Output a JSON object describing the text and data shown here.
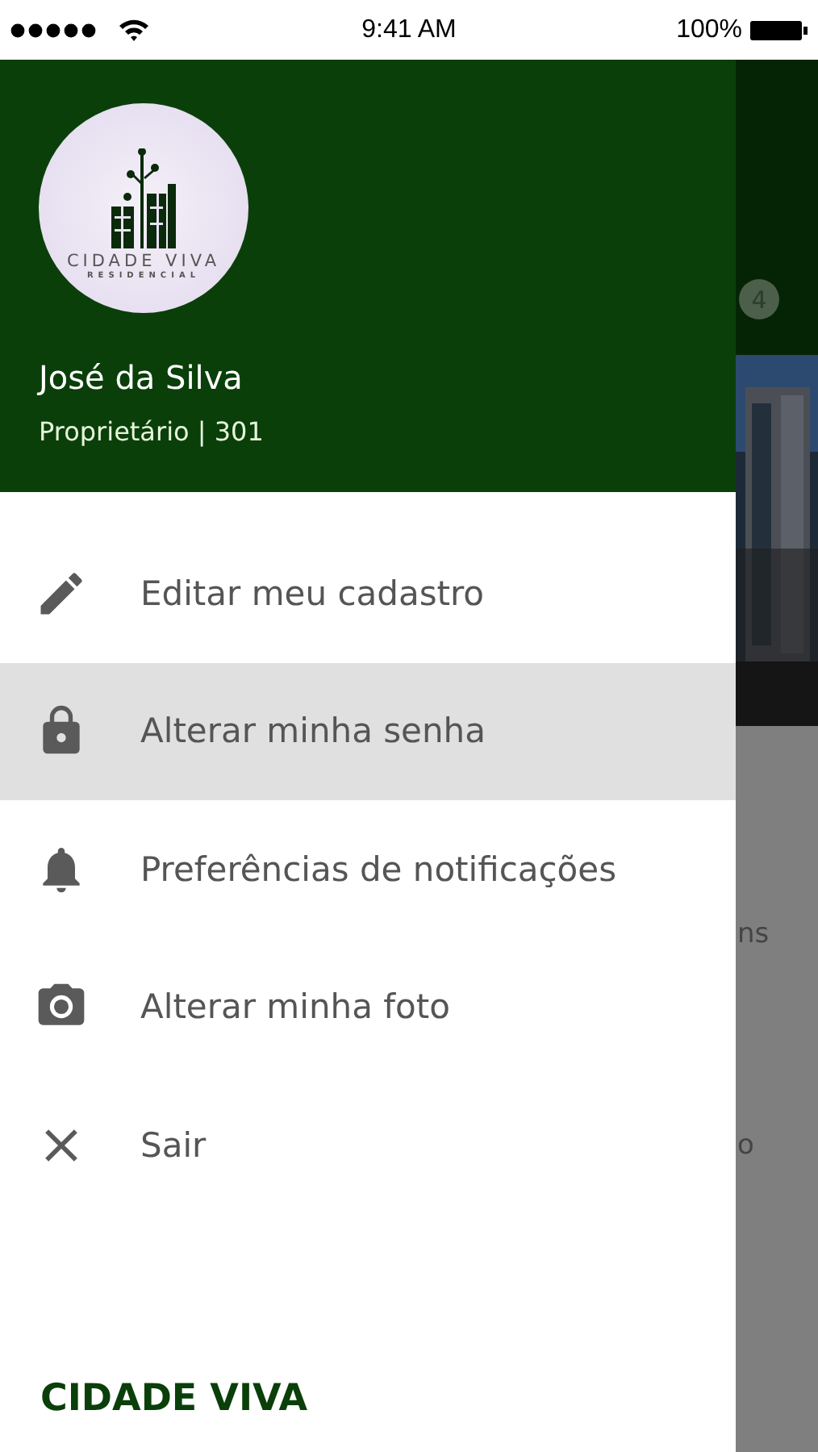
{
  "status_bar": {
    "time": "9:41 AM",
    "battery": "100%"
  },
  "profile": {
    "logo_title": "CIDADE VIVA",
    "logo_subtitle": "RESIDENCIAL",
    "name": "José da Silva",
    "role": "Proprietário | 301"
  },
  "menu": [
    {
      "label": "Editar meu cadastro",
      "kind": "pencil",
      "selected": false
    },
    {
      "label": "Alterar minha senha",
      "kind": "lock",
      "selected": true
    },
    {
      "label": "Preferências de notificações",
      "kind": "bell",
      "selected": false
    },
    {
      "label": "Alterar minha foto",
      "kind": "camera",
      "selected": false
    },
    {
      "label": "Sair",
      "kind": "close",
      "selected": false
    }
  ],
  "footer": {
    "brand": "CIDADE VIVA"
  },
  "background": {
    "badge": "4",
    "text_fragments": [
      "ns",
      "o"
    ]
  }
}
